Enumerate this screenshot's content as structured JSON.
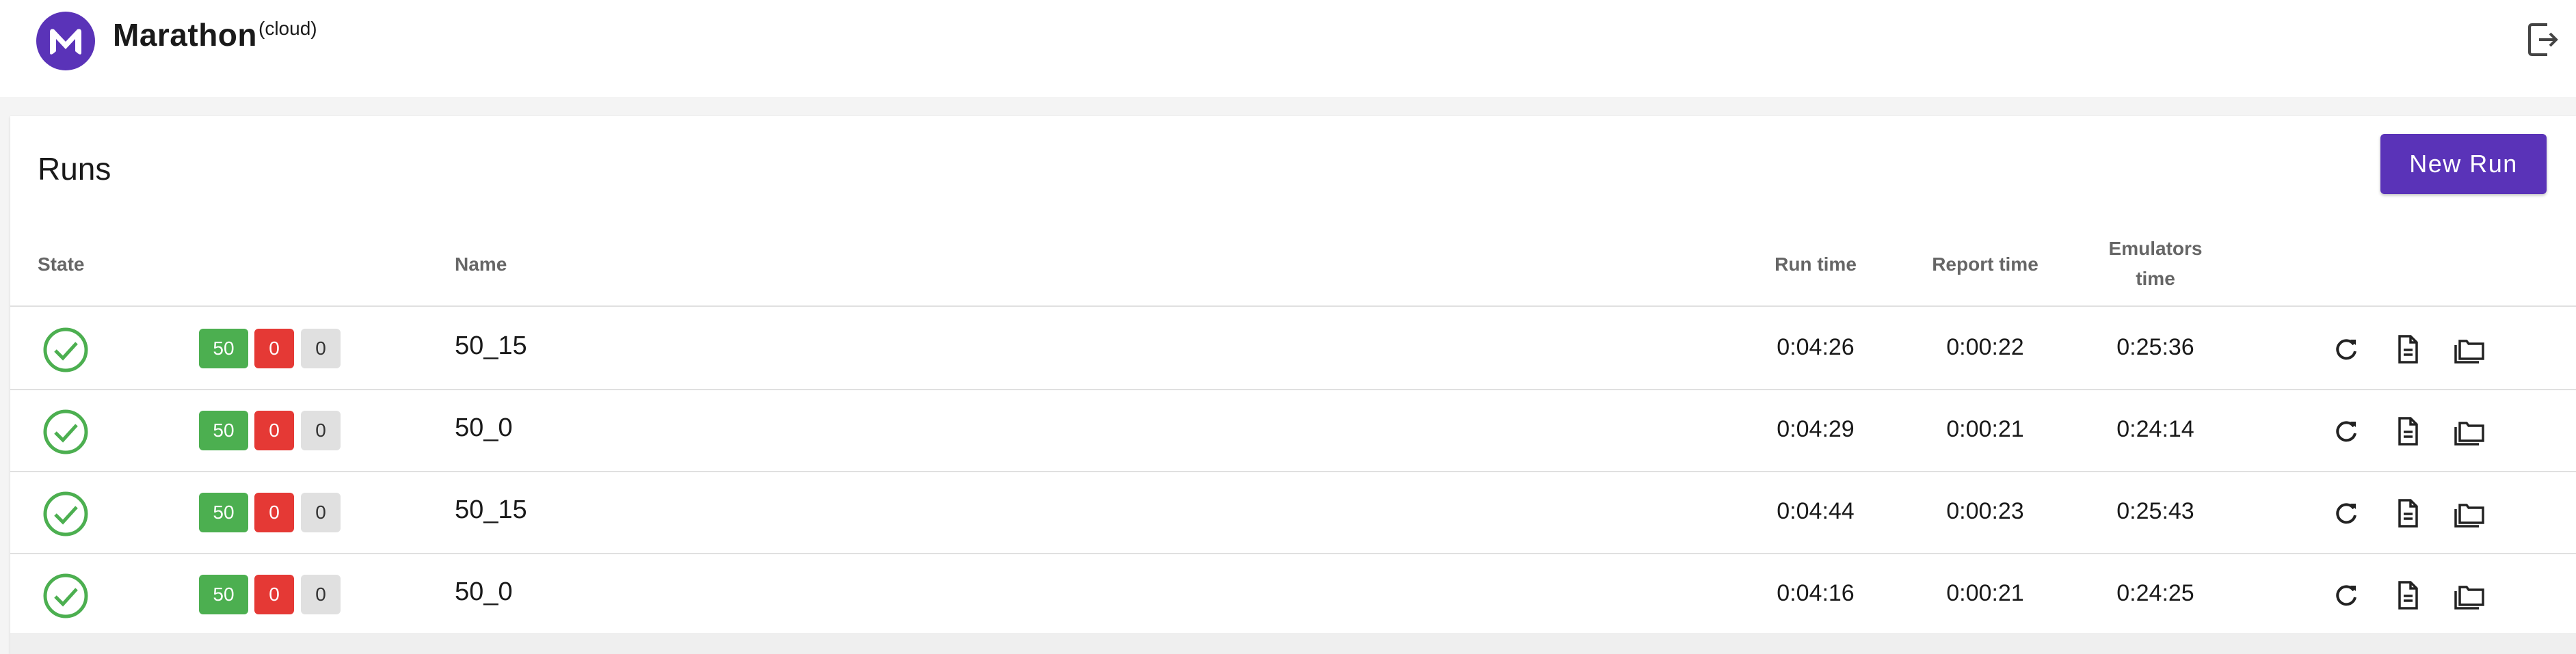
{
  "app": {
    "brand": "Marathon",
    "brand_suffix": "(cloud)",
    "logo_icon": "marathon-m-logo",
    "logout_icon": "logout-icon",
    "accent_color": "#5a33b8"
  },
  "runs": {
    "title": "Runs",
    "new_run_label": "New Run",
    "columns": {
      "state": "State",
      "name": "Name",
      "run_time": "Run time",
      "report_time": "Report time",
      "emulators_time_line1": "Emulators",
      "emulators_time_line2": "time"
    },
    "rows": [
      {
        "passed": "50",
        "failed": "0",
        "skipped": "0",
        "name": "50_15",
        "run_time": "0:04:26",
        "report_time": "0:00:22",
        "emulators_time": "0:25:36"
      },
      {
        "passed": "50",
        "failed": "0",
        "skipped": "0",
        "name": "50_0",
        "run_time": "0:04:29",
        "report_time": "0:00:21",
        "emulators_time": "0:24:14"
      },
      {
        "passed": "50",
        "failed": "0",
        "skipped": "0",
        "name": "50_15",
        "run_time": "0:04:44",
        "report_time": "0:00:23",
        "emulators_time": "0:25:43"
      },
      {
        "passed": "50",
        "failed": "0",
        "skipped": "0",
        "name": "50_0",
        "run_time": "0:04:16",
        "report_time": "0:00:21",
        "emulators_time": "0:24:25"
      }
    ],
    "colors": {
      "success": "#4caf50",
      "failed": "#e53935",
      "skipped": "#e0e0e0"
    }
  }
}
